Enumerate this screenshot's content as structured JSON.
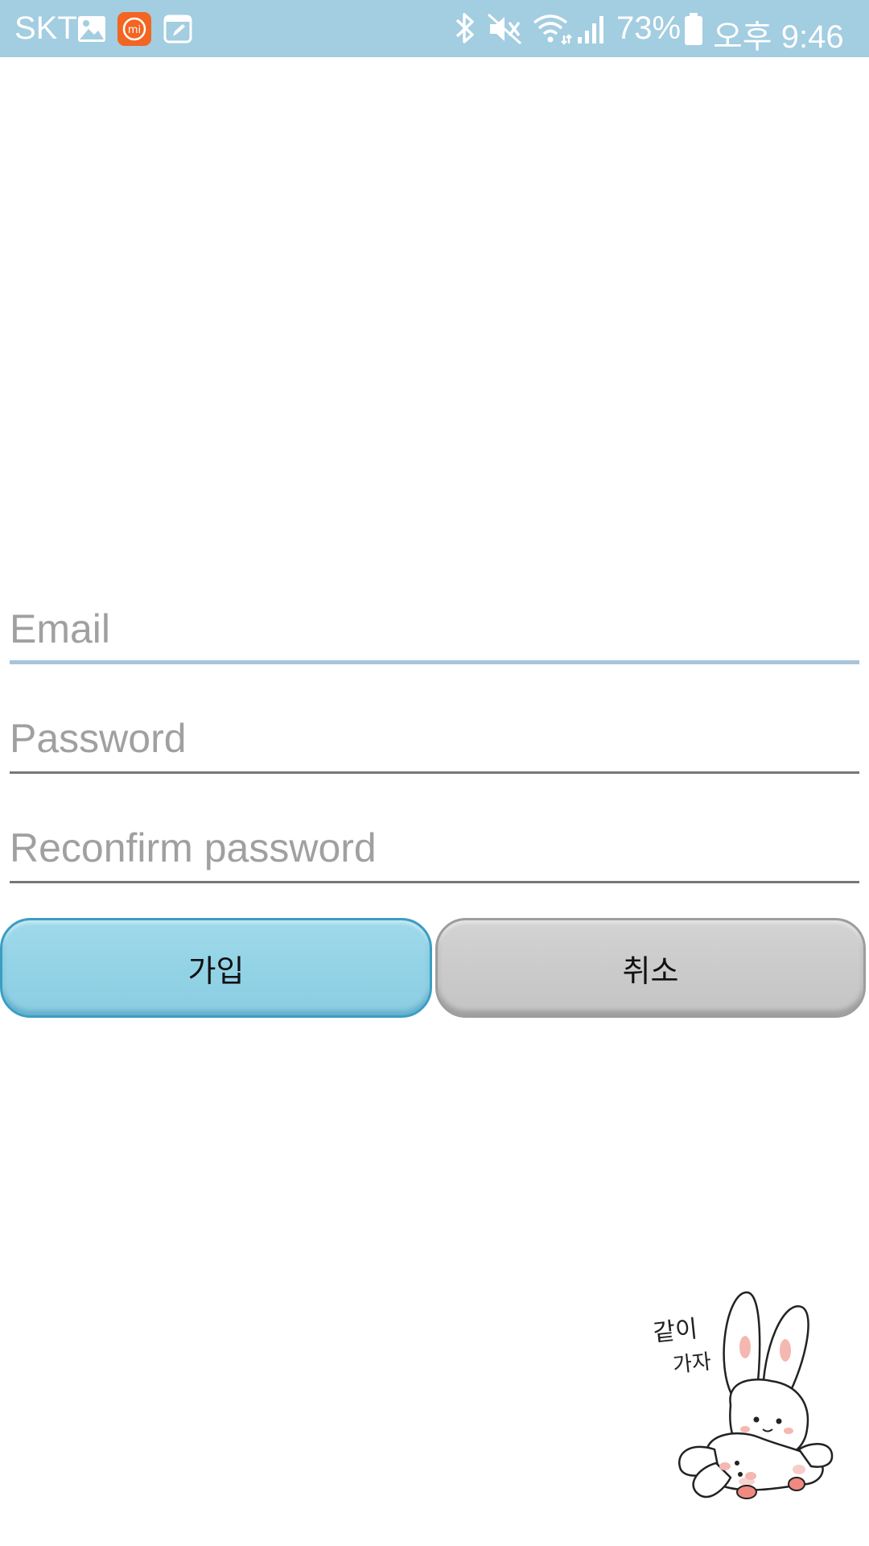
{
  "status_bar": {
    "carrier": "SKT",
    "battery_percent": "73%",
    "time": "오후 9:46",
    "background_color": "#a3cde0",
    "left_icons": [
      "gallery-icon",
      "mi-app-icon",
      "note-icon"
    ],
    "right_icons": [
      "bluetooth-icon",
      "mute-icon",
      "wifi-icon",
      "signal-icon",
      "battery-icon"
    ]
  },
  "form": {
    "email": {
      "placeholder": "Email",
      "value": ""
    },
    "password": {
      "placeholder": "Password",
      "value": ""
    },
    "reconfirm_password": {
      "placeholder": "Reconfirm password",
      "value": ""
    }
  },
  "buttons": {
    "join_label": "가입",
    "cancel_label": "취소",
    "join_color": "#93d3e6",
    "cancel_color": "#cbcbcb"
  },
  "sticker": {
    "text_line1": "같이",
    "text_line2": "가자",
    "icon": "bunny-sticker"
  }
}
